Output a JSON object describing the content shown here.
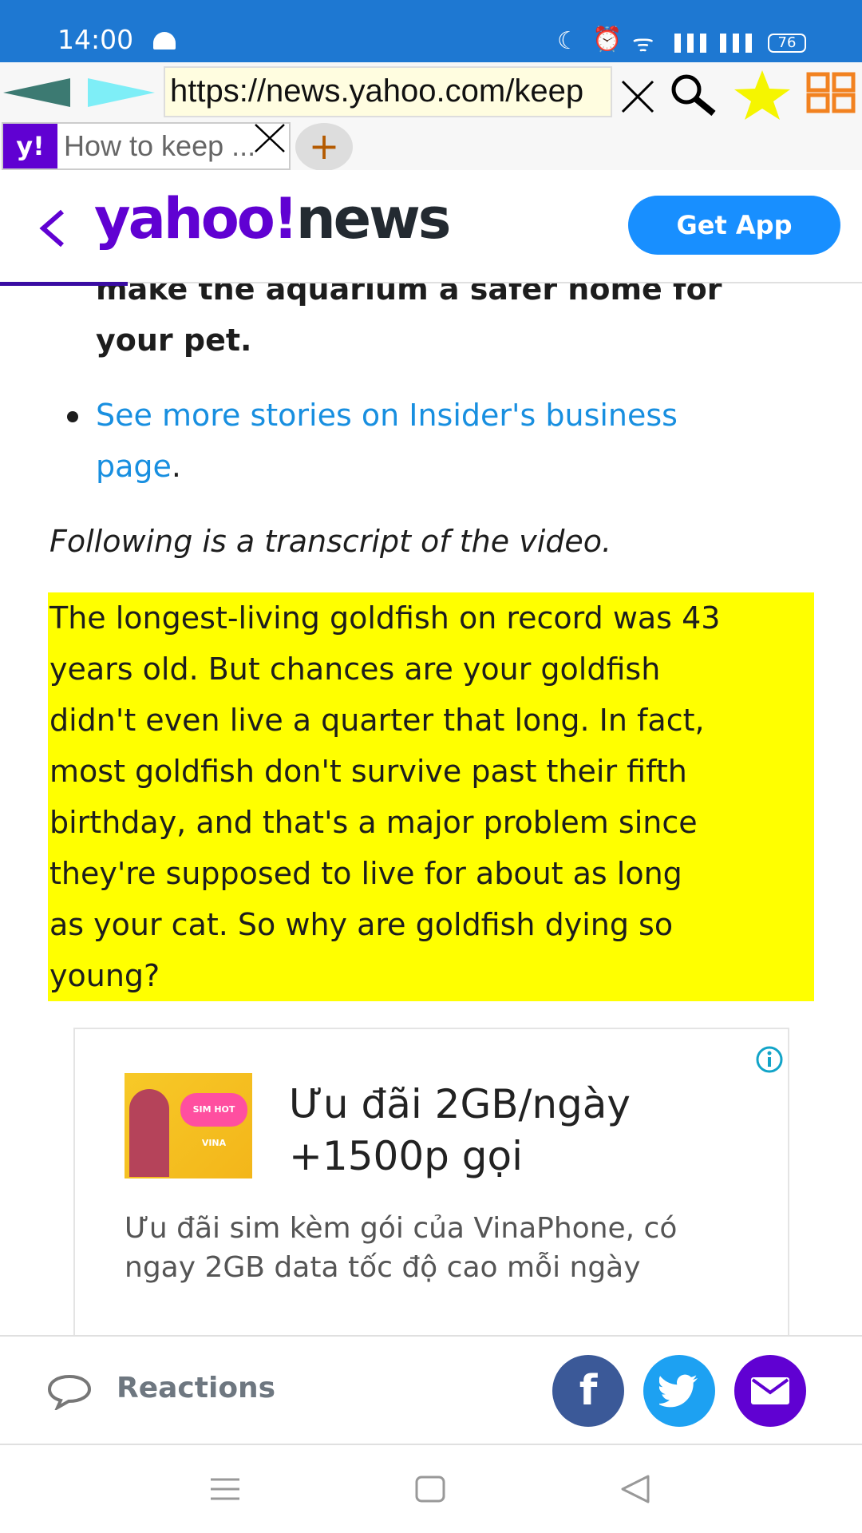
{
  "status_bar": {
    "time": "14:00",
    "battery": "76"
  },
  "browser": {
    "url": "https://news.yahoo.com/keep",
    "tab_title": "How to keep ...",
    "tab_favicon": "y!",
    "new_tab": "+"
  },
  "header": {
    "logo_yahoo": "yahoo!",
    "logo_news": "news",
    "get_app": "Get App"
  },
  "article": {
    "partial_line": "make the aquarium a safer home for",
    "partial_line2": "your pet.",
    "bullet_link": "See more stories on Insider's business page",
    "bullet_end": ".",
    "intro": "Following is a transcript of the video.",
    "highlight_lines": [
      "The longest-living goldfish on record was 43",
      "years old. But chances are your goldfish",
      "didn't even live a quarter that long. In fact,",
      "most goldfish don't survive past their fifth",
      "birthday, and that's a major problem since",
      "they're supposed to live for about as long",
      "as your cat. So why are goldfish dying so",
      "young?"
    ]
  },
  "ad": {
    "title_lines": [
      "Ưu đãi 2GB/ngày",
      "+1500p gọi"
    ],
    "description": "Ưu đãi sim kèm gói của VinaPhone, có ngay 2GB data tốc độ cao mỗi ngày",
    "image_text": "SIM HOT VINA"
  },
  "bottom_bar": {
    "reactions": "Reactions",
    "facebook": "f",
    "colors": {
      "facebook": "#3b5998",
      "twitter": "#1da1f2",
      "mail": "#6001d2"
    }
  },
  "colors": {
    "status_bar": "#1e78d2",
    "highlight": "#ffff00",
    "link": "#188fe0",
    "yahoo_purple": "#6001d2",
    "get_app": "#188fff"
  }
}
